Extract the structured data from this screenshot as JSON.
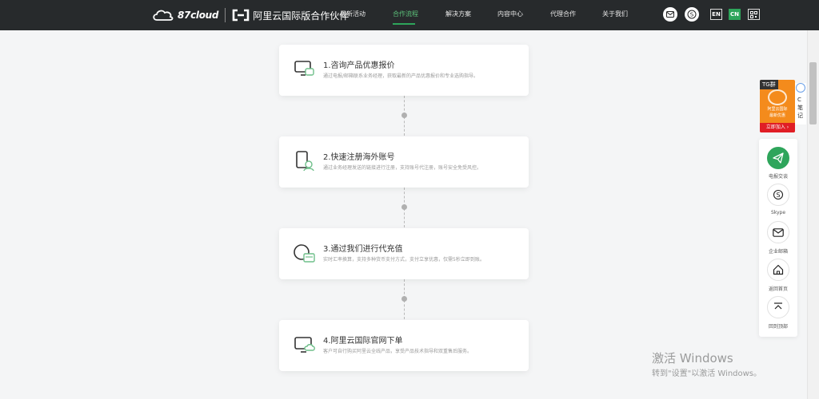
{
  "brand": {
    "logo_text": "87cloud",
    "partner_text": "阿里云国际版合作伙伴"
  },
  "nav": {
    "items": [
      {
        "label": "最新活动",
        "active": false
      },
      {
        "label": "合作流程",
        "active": true
      },
      {
        "label": "解决方案",
        "active": false
      },
      {
        "label": "内容中心",
        "active": false
      },
      {
        "label": "代理合作",
        "active": false
      },
      {
        "label": "关于我们",
        "active": false
      }
    ]
  },
  "top_tools": {
    "email_icon": "mail-icon",
    "skype_icon": "skype-icon",
    "lang_en": "EN",
    "lang_cn": "CN",
    "qr_icon": "qrcode-icon"
  },
  "steps": [
    {
      "icon": "monitor-chat-icon",
      "title": "1.咨询产品优惠报价",
      "desc": "通过电报/邮箱联系业务经理，获取最新的产品优惠报价和专业选购指导。"
    },
    {
      "icon": "phone-user-icon",
      "title": "2.快速注册海外账号",
      "desc": "通过业务经理发送的链接进行注册，支持账号代注册，账号安全免受风控。"
    },
    {
      "icon": "coin-card-icon",
      "title": "3.通过我们进行代充值",
      "desc": "实时汇率换算，支持多种货币支付方式，支付立享优惠，仅需5秒立即到账。"
    },
    {
      "icon": "monitor-cloud-icon",
      "title": "4.阿里云国际官网下单",
      "desc": "客户可自行购买阿里云全线产品，享受产品技术指导和双重售后服务。"
    }
  ],
  "promo": {
    "tag": "TG群",
    "line1": "阿里云国际",
    "line2": "最新优惠",
    "join": "立即加入 ›"
  },
  "note_tab": {
    "text": "C笔记"
  },
  "side_tools": [
    {
      "icon": "telegram-icon",
      "label": "电报交谈"
    },
    {
      "icon": "skype-icon",
      "label": "Skype"
    },
    {
      "icon": "mail-icon",
      "label": "企业邮箱"
    },
    {
      "icon": "home-icon",
      "label": "返回首页"
    },
    {
      "icon": "back-to-top-icon",
      "label": "回到顶部"
    }
  ],
  "watermark": {
    "title": "激活 Windows",
    "subtitle": "转到\"设置\"以激活 Windows。"
  },
  "colors": {
    "topbar_bg": "#272a2c",
    "accent_green": "#2ea55b",
    "promo_orange": "#f48b1c",
    "promo_red": "#e01e25"
  }
}
